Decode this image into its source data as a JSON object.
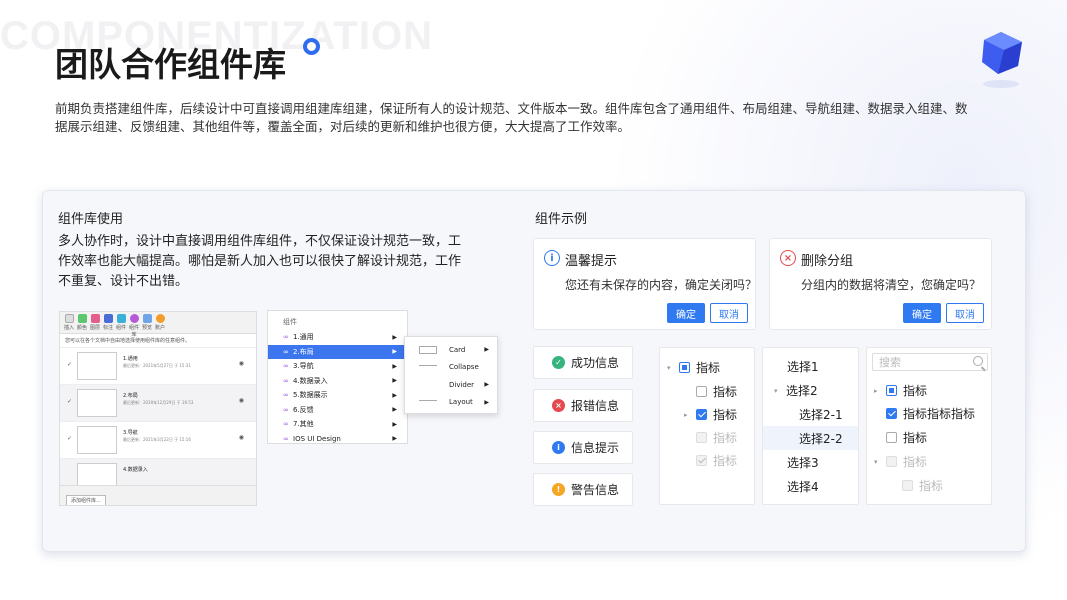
{
  "watermark": "COMPONENTIZATION",
  "title": "团队合作组件库",
  "intro": "前期负责搭建组件库，后续设计中可直接调用组建库组建，保证所有人的设计规范、文件版本一致。组件库包含了通用组件、布局组建、导航组建、数据录入组建、数据展示组建、反馈组建、其他组件等，覆盖全面，对后续的更新和维护也很方便，大大提高了工作效率。",
  "usage": {
    "title": "组件库使用",
    "text": "多人协作时，设计中直接调用组件库组件，不仅保证设计规范一致，工作效率也能大幅提高。哪怕是新人加入也可以很快了解设计规范，工作不重复、设计不出错。"
  },
  "library": {
    "tools": [
      "插入",
      "颜色",
      "图层",
      "标注",
      "组件",
      "组件库",
      "预览",
      "账户"
    ],
    "note": "您可以在各个文档中自由地选择使用组件库的任意组件。",
    "items": [
      {
        "name": "1.通用",
        "date": "最后更新：2021年5月27日 于 15:31"
      },
      {
        "name": "2.布局",
        "date": "最后更新：2020年12月29日 于 16:53"
      },
      {
        "name": "3.导航",
        "date": "最后更新：2021年3月22日 于 15:16"
      },
      {
        "name": "4.数据录入",
        "date": ""
      }
    ],
    "add_button": "添加组件库..."
  },
  "menu": {
    "header": "组件",
    "items": [
      "1.通用",
      "2.布局",
      "3.导航",
      "4.数据录入",
      "5.数据展示",
      "6.反馈",
      "7.其他",
      "IOS UI Design"
    ],
    "submenu": [
      "Card",
      "Collapse",
      "Divider",
      "Layout"
    ]
  },
  "examples": {
    "title": "组件示例",
    "dialog1": {
      "title": "温馨提示",
      "message": "您还有未保存的内容，确定关闭吗？",
      "ok": "确定",
      "cancel": "取消"
    },
    "dialog2": {
      "title": "删除分组",
      "message": "分组内的数据将清空，您确定吗？",
      "ok": "确定",
      "cancel": "取消"
    },
    "messages": [
      {
        "label": "成功信息",
        "color": "#36b37e",
        "icon": "check-icon"
      },
      {
        "label": "报错信息",
        "color": "#e5484d",
        "icon": "close-icon"
      },
      {
        "label": "信息提示",
        "color": "#2f7af0",
        "icon": "info-icon"
      },
      {
        "label": "警告信息",
        "color": "#f5a623",
        "icon": "warning-icon"
      }
    ],
    "checkbox_tree": [
      "指标",
      "指标",
      "指标",
      "指标",
      "指标"
    ],
    "select_tree": [
      "选择1",
      "选择2",
      "选择2-1",
      "选择2-2",
      "选择3",
      "选择4"
    ],
    "search_tree": {
      "placeholder": "搜索",
      "items": [
        "指标",
        "指标指标指标",
        "指标",
        "指标",
        "指标"
      ]
    }
  },
  "colors": {
    "accent": "#2f7af0",
    "menu_active": "#3b76ef"
  }
}
